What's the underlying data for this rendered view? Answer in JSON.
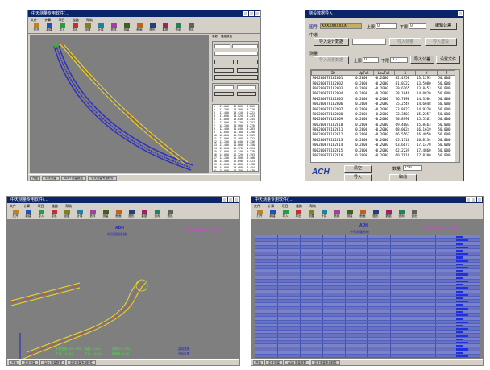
{
  "panel_tl": {
    "title": "中天测量专用软件(...",
    "menu": [
      "文件",
      "计算",
      "项目",
      "道路",
      "帮助"
    ],
    "tools": [
      "打开",
      "新建",
      "导入",
      "导出",
      "设置",
      "计算",
      "放样",
      "测量",
      "断面",
      "图形",
      "数据",
      "查询",
      "退出"
    ],
    "side_labels": [
      "参数",
      "道路数据",
      "平",
      "纵",
      "横"
    ],
    "side_values": [
      "",
      ""
    ],
    "mini_table": {
      "rows": [
        [
          "1",
          "11.000",
          "10.200",
          "0.205"
        ],
        [
          "2",
          "11.200",
          "10.300",
          "0.210"
        ],
        [
          "3",
          "11.400",
          "10.410",
          "0.221"
        ],
        [
          "4",
          "11.600",
          "10.520",
          "0.233"
        ],
        [
          "5",
          "11.800",
          "10.640",
          "0.245"
        ],
        [
          "6",
          "12.000",
          "10.770",
          "0.257"
        ],
        [
          "7",
          "12.200",
          "10.900",
          "0.270"
        ],
        [
          "8",
          "12.400",
          "11.040",
          "0.283"
        ],
        [
          "9",
          "12.600",
          "11.180",
          "0.296"
        ],
        [
          "10",
          "12.800",
          "11.330",
          "0.309"
        ],
        [
          "11",
          "13.000",
          "11.480",
          "0.322"
        ],
        [
          "12",
          "13.200",
          "11.640",
          "0.336"
        ],
        [
          "13",
          "13.400",
          "11.800",
          "0.350"
        ],
        [
          "14",
          "13.600",
          "11.970",
          "0.364"
        ],
        [
          "15",
          "13.800",
          "12.140",
          "0.378"
        ],
        [
          "16",
          "14.000",
          "12.320",
          "0.393"
        ],
        [
          "17",
          "14.200",
          "12.500",
          "0.408"
        ],
        [
          "18",
          "14.400",
          "12.690",
          "0.423"
        ],
        [
          "19",
          "14.600",
          "12.880",
          "0.438"
        ],
        [
          "20",
          "14.800",
          "13.080",
          "0.454"
        ],
        [
          "21",
          "15.000",
          "13.280",
          "0.470"
        ],
        [
          "22",
          "15.200",
          "13.490",
          "0.486"
        ]
      ]
    },
    "status": "中段曲线表  导入正确",
    "taskbar": [
      "开始",
      "中天测量",
      "ADH 测量数据",
      "中天测量专用软件"
    ]
  },
  "panel_tr": {
    "title": "测设数据导入",
    "label_name": "图号",
    "name_value": "XXXXXXXXXX",
    "label_up": "上限",
    "up_value": "0",
    "label_down": "下限",
    "down_value": "0",
    "btn_edit_top": "编辑公差",
    "section_mid": "中道",
    "btn_import_design": "导入设计数据",
    "btn_import_measure": "导入测量",
    "btn_import_alt": "导入建设",
    "section_side": "测量",
    "btn_import_side": "导入测量数据",
    "label_up2": "上限",
    "up2_value": "0",
    "label_down2": "下限",
    "down2_value": "0.2",
    "btn_import_side2": "导入公差",
    "btn_setfile": "设置文件",
    "table_headers": [
      "ID",
      "UpTol",
      "LowTol",
      "X",
      "Y",
      "Z"
    ],
    "table_rows": [
      [
        "P00200078102001",
        "0.2000",
        "-0.2000",
        "82.4950",
        "13.1295",
        "50.000"
      ],
      [
        "P00200078102002",
        "0.2000",
        "-0.2000",
        "81.0722",
        "13.5080",
        "50.000"
      ],
      [
        "P00200078102003",
        "0.2000",
        "-0.2000",
        "79.6165",
        "13.8453",
        "50.000"
      ],
      [
        "P00200078102004",
        "0.2000",
        "-0.2000",
        "78.1646",
        "14.0820",
        "50.000"
      ],
      [
        "P00200078102005",
        "0.2000",
        "-0.2000",
        "76.7090",
        "14.3584",
        "50.000"
      ],
      [
        "P00200078102006",
        "0.2000",
        "-0.2000",
        "75.2549",
        "14.6648",
        "50.000"
      ],
      [
        "P00200078102007",
        "0.2000",
        "-0.2000",
        "73.8023",
        "14.9370",
        "50.000"
      ],
      [
        "P00200078102008",
        "0.2000",
        "-0.2000",
        "72.3503",
        "15.2257",
        "50.000"
      ],
      [
        "P00200078102009",
        "0.2000",
        "-0.2000",
        "70.8990",
        "15.5361",
        "50.000"
      ],
      [
        "P00200078102010",
        "0.2000",
        "-0.2000",
        "69.4003",
        "15.8463",
        "50.000"
      ],
      [
        "P00200078102011",
        "0.2000",
        "-0.2000",
        "68.0024",
        "16.1619",
        "50.000"
      ],
      [
        "P00200078102012",
        "0.2000",
        "-0.2000",
        "66.5563",
        "16.4850",
        "50.000"
      ],
      [
        "P00200078102013",
        "0.2000",
        "-0.2000",
        "65.1116",
        "16.8134",
        "50.000"
      ],
      [
        "P00200078102014",
        "0.2000",
        "-0.2000",
        "63.6671",
        "17.1470",
        "50.000"
      ],
      [
        "P00200078102015",
        "0.2000",
        "-0.2000",
        "62.2239",
        "17.4860",
        "50.000"
      ],
      [
        "P00200078102016",
        "0.2000",
        "-0.2000",
        "60.7816",
        "17.8300",
        "50.000"
      ]
    ],
    "btn_clear": "清空",
    "btn_import": "导入",
    "label_count": "数量",
    "count_value": "150",
    "btn_cancel": "取消",
    "logo": "ACH"
  },
  "panel_bl": {
    "title": "中天测量专用软件(...",
    "menu": [
      "文件",
      "计算",
      "项目",
      "道路",
      "帮助"
    ],
    "tools": [
      "打开",
      "新建",
      "导入",
      "导出",
      "设置",
      "计算",
      "放样",
      "测量",
      "断面",
      "图形",
      "数据",
      "查询",
      "退出"
    ],
    "logo": "ADH",
    "subtitle": "中天测量系统",
    "corner_text": "平面设计图  放大1:1.000",
    "info_left": [
      "中桩里程: K0+360",
      "偏距: 0.000",
      "左边: 10.000",
      "右边: 10.000"
    ],
    "info_right": [
      "里程 K0+360",
      "偏移量: 0.00",
      "曲线要素",
      "坐标位置"
    ],
    "taskbar": [
      "开始",
      "中天测量",
      "ADH 测量数据",
      "中天测量专用软件"
    ],
    "colors": {
      "canvas": "#7f7f7f",
      "line_yellow": "#e0e020",
      "line_red": "#d04040",
      "axis_blue": "#2020c0",
      "axis_red": "#c02020"
    }
  },
  "panel_br": {
    "title": "中天测量专用软件(...",
    "menu": [
      "文件",
      "计算",
      "项目",
      "道路",
      "帮助"
    ],
    "tools": [
      "打开",
      "新建",
      "导入",
      "导出",
      "设置",
      "计算",
      "放样",
      "测量",
      "断面",
      "图形",
      "数据",
      "查询",
      "退出"
    ],
    "logo": "ADH",
    "subtitle": "中天测量系统",
    "corner_text": "测量结果  偏差 1:1.000",
    "grid_rows": 36,
    "taskbar": [
      "开始",
      "中天测量",
      "ADH 测量数据",
      "中天测量专用软件"
    ]
  }
}
